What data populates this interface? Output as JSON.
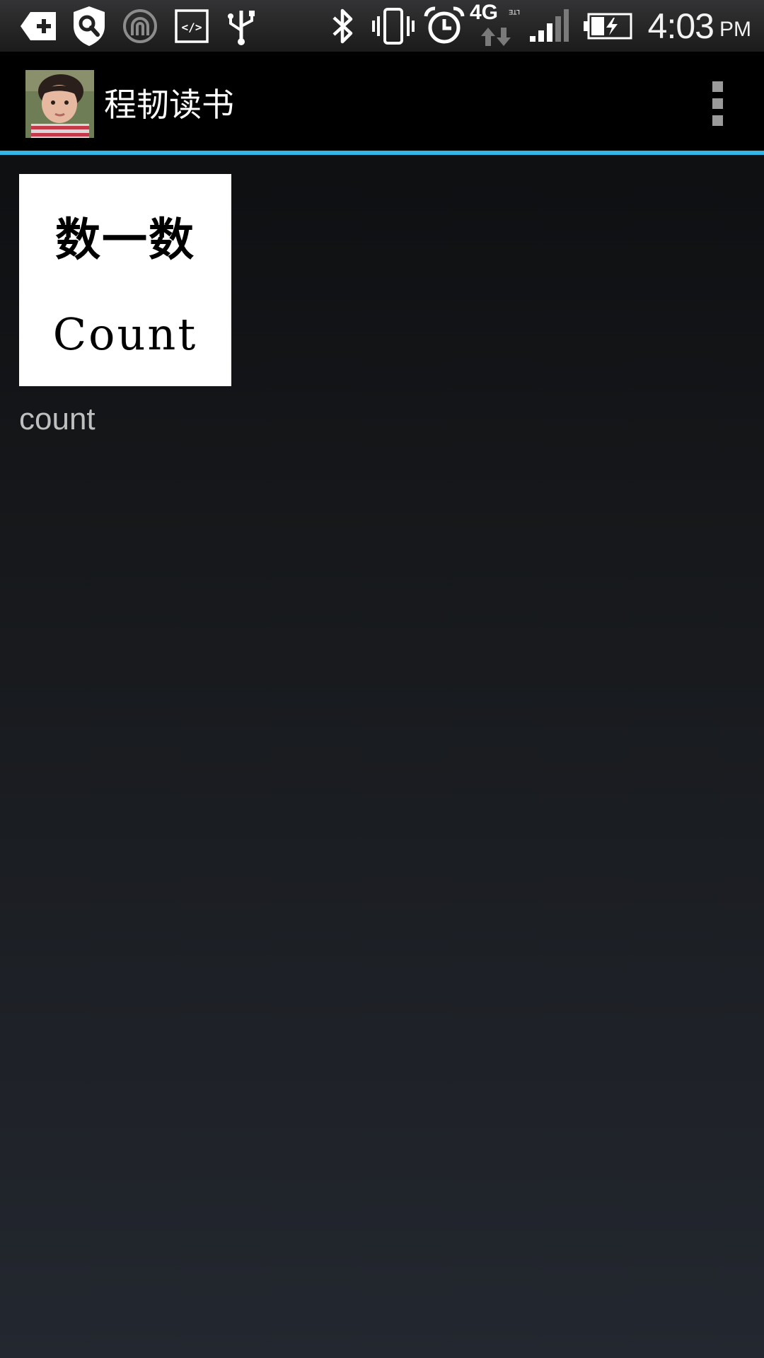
{
  "status_bar": {
    "icons": [
      "app-add-icon",
      "search-shield-icon",
      "wireless-icon",
      "code-icon",
      "usb-icon",
      "bluetooth-icon",
      "vibrate-icon",
      "alarm-icon",
      "4g-lte-icon",
      "signal-icon",
      "battery-charging-icon"
    ],
    "network_label": "4G",
    "network_sub": "LTE",
    "time": "4:03",
    "ampm": "PM"
  },
  "action_bar": {
    "title": "程韧读书",
    "accent_color": "#33b5e5"
  },
  "content": {
    "items": [
      {
        "image_title_cn": "数一数",
        "image_title_en": "Count",
        "caption": "count"
      }
    ]
  }
}
